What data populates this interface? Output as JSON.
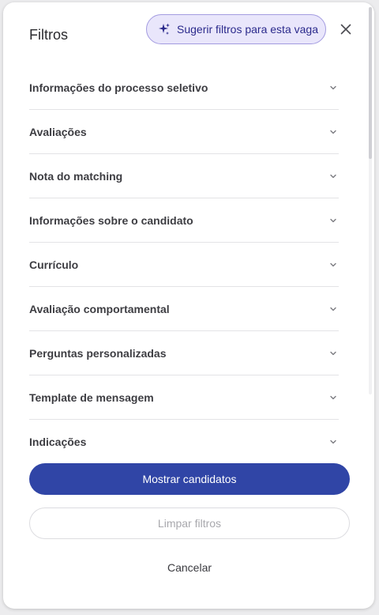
{
  "header": {
    "title": "Filtros",
    "suggest_button_label": "Sugerir filtros para esta vaga",
    "suggest_icon": "sparkle-icon",
    "close_icon": "close-icon"
  },
  "filters": {
    "items": [
      {
        "label": "Informações do processo seletivo"
      },
      {
        "label": "Avaliações"
      },
      {
        "label": "Nota do matching"
      },
      {
        "label": "Informações sobre o candidato"
      },
      {
        "label": "Currículo"
      },
      {
        "label": "Avaliação comportamental"
      },
      {
        "label": "Perguntas personalizadas"
      },
      {
        "label": "Template de mensagem"
      },
      {
        "label": "Indicações"
      }
    ],
    "expand_icon": "chevron-down-icon"
  },
  "actions": {
    "show_label": "Mostrar candidatos",
    "clear_label": "Limpar filtros",
    "cancel_label": "Cancelar"
  },
  "colors": {
    "primary": "#3045a6",
    "suggest_bg": "#e9e6fb",
    "suggest_text": "#2b2a8c"
  }
}
